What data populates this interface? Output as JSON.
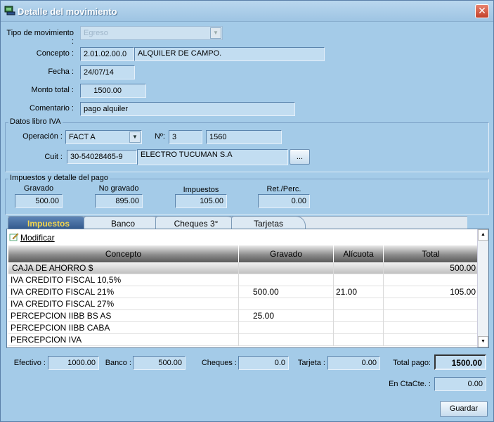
{
  "window": {
    "title": "Detalle del movimiento",
    "close": "✕"
  },
  "form": {
    "tipo_label": "Tipo de movimiento :",
    "tipo_value": "Egreso",
    "concepto_label": "Concepto :",
    "concepto_code": "2.01.02.00.0",
    "concepto_desc": "ALQUILER DE CAMPO.",
    "fecha_label": "Fecha :",
    "fecha_value": "24/07/14",
    "monto_label": "Monto total :",
    "monto_value": "1500.00",
    "comentario_label": "Comentario :",
    "comentario_value": "pago alquiler"
  },
  "iva": {
    "legend": "Datos libro IVA",
    "operacion_label": "Operación :",
    "operacion_value": "FACT A",
    "nro_label": "Nº:",
    "nro_pv": "3",
    "nro_num": "1560",
    "cuit_label": "Cuit :",
    "cuit_value": "30-54028465-9",
    "razon_social": "ELECTRO TUCUMAN S.A",
    "browse_label": "..."
  },
  "impuestos": {
    "legend": "Impuestos y detalle del pago",
    "gravado_label": "Gravado",
    "gravado_value": "500.00",
    "no_gravado_label": "No gravado",
    "no_gravado_value": "895.00",
    "impuestos_label": "Impuestos",
    "impuestos_value": "105.00",
    "ret_label": "Ret./Perc.",
    "ret_value": "0.00"
  },
  "tabs": [
    "Impuestos",
    "Banco",
    "Cheques 3°",
    "Tarjetas"
  ],
  "grid": {
    "modificar_label": "Modificar",
    "columns": [
      "Concepto",
      "Gravado",
      "Alícuota",
      "Total"
    ],
    "rows": [
      {
        "concepto": "CAJA DE AHORRO $",
        "gravado": "",
        "alicuota": "",
        "total": "500.00"
      },
      {
        "concepto": "IVA CREDITO FISCAL 10,5%",
        "gravado": "",
        "alicuota": "",
        "total": ""
      },
      {
        "concepto": "IVA CREDITO FISCAL 21%",
        "gravado": "500.00",
        "alicuota": "21.00",
        "total": "105.00"
      },
      {
        "concepto": "IVA CREDITO FISCAL 27%",
        "gravado": "",
        "alicuota": "",
        "total": ""
      },
      {
        "concepto": "PERCEPCION IIBB BS AS",
        "gravado": "25.00",
        "alicuota": "",
        "total": ""
      },
      {
        "concepto": "PERCEPCION IIBB CABA",
        "gravado": "",
        "alicuota": "",
        "total": ""
      },
      {
        "concepto": "PERCEPCION IVA",
        "gravado": "",
        "alicuota": "",
        "total": ""
      }
    ]
  },
  "totals": {
    "efectivo_label": "Efectivo :",
    "efectivo_value": "1000.00",
    "banco_label": "Banco :",
    "banco_value": "500.00",
    "cheques_label": "Cheques :",
    "cheques_value": "0.0",
    "tarjeta_label": "Tarjeta :",
    "tarjeta_value": "0.00",
    "total_pago_label": "Total pago:",
    "total_pago_value": "1500.00",
    "ctacte_label": "En CtaCte. :",
    "ctacte_value": "0.00"
  },
  "actions": {
    "guardar": "Guardar"
  }
}
